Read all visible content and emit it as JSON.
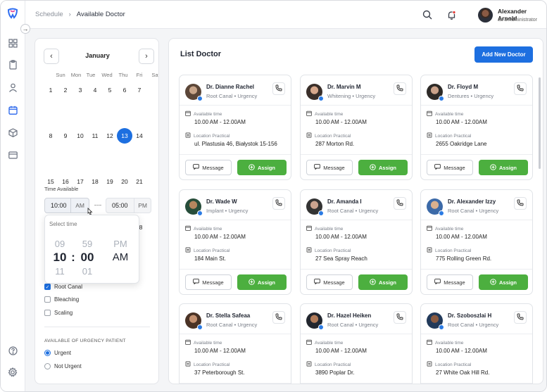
{
  "breadcrumb": {
    "parent": "Schedule",
    "separator": "›",
    "current": "Available Doctor"
  },
  "user": {
    "name": "Alexander Arnold",
    "role": "as a Administrator"
  },
  "calendar": {
    "month": "January",
    "prev_icon": "chevron-left-icon",
    "next_icon": "chevron-right-icon",
    "weekdays": [
      "Sun",
      "Mon",
      "Tue",
      "Wed",
      "Thu",
      "Fri",
      "Sat"
    ],
    "row1": [
      "1",
      "2",
      "3",
      "4",
      "5",
      "6",
      "7"
    ],
    "row2": [
      "8",
      "9",
      "10",
      "11",
      "12",
      "13",
      "14"
    ],
    "row3": [
      "15",
      "16",
      "17",
      "18",
      "19",
      "20",
      "21"
    ],
    "row4_partial": "8",
    "selected_day": "13"
  },
  "time": {
    "label": "Time Available",
    "start": "10:00",
    "start_period": "AM",
    "end": "05:00",
    "end_period": "PM",
    "picker_title": "Select time",
    "hours": [
      "09",
      "10",
      "11"
    ],
    "minutes": [
      "59",
      "00",
      "01"
    ],
    "periods": [
      "PM",
      "AM"
    ],
    "separator": ":"
  },
  "filters": {
    "treatments": [
      {
        "label": "Root Canal",
        "checked": true
      },
      {
        "label": "Bleaching",
        "checked": false
      },
      {
        "label": "Scaling",
        "checked": false
      }
    ],
    "urgency_title": "AVAILABLE OF URGENCY PATIENT",
    "urgency": [
      {
        "label": "Urgent",
        "selected": true
      },
      {
        "label": "Not Urgent",
        "selected": false
      }
    ]
  },
  "list": {
    "title": "List Doctor",
    "add_label": "Add New Doctor",
    "time_label": "Available time",
    "location_label": "Location Practical",
    "message_label": "Message",
    "assign_label": "Assign",
    "doctors": [
      {
        "name": "Dr. Dianne Rachel",
        "spec": "Root Canal • Urgency",
        "time": "10.00 AM - 12.00AM",
        "location": "ul. Plastusia 46, Białystok 15-156"
      },
      {
        "name": "Dr. Marvin M",
        "spec": "Whitening • Urgency",
        "time": "10.00 AM - 12.00AM",
        "location": "287 Morton Rd."
      },
      {
        "name": "Dr. Floyd M",
        "spec": "Dentures • Urgency",
        "time": "10.00 AM - 12.00AM",
        "location": "2655 Oakridge Lane"
      },
      {
        "name": "Dr. Wade W",
        "spec": "Implant • Urgency",
        "time": "10.00 AM - 12.00AM",
        "location": "184 Main St."
      },
      {
        "name": "Dr. Amanda I",
        "spec": "Root Canal • Urgency",
        "time": "10.00 AM - 12.00AM",
        "location": "27 Sea Spray Reach"
      },
      {
        "name": "Dr. Alexander Izzy",
        "spec": "Root Canal • Urgency",
        "time": "10.00 AM - 12.00AM",
        "location": "775 Rolling Green Rd."
      },
      {
        "name": "Dr. Stella Safeaa",
        "spec": "Root Canal • Urgency",
        "time": "10.00 AM - 12.00AM",
        "location": "37 Peterborough St."
      },
      {
        "name": "Dr. Hazel Heiken",
        "spec": "Root Canal • Urgency",
        "time": "10.00 AM - 12.00AM",
        "location": "3890 Poplar Dr."
      },
      {
        "name": "Dr. Szoboszlai H",
        "spec": "Root Canal • Urgency",
        "time": "10.00 AM - 12.00AM",
        "location": "27 White Oak Hill Rd."
      }
    ]
  },
  "colors": {
    "primary": "#1d6fe0",
    "assign": "#4caf3f",
    "background": "#f4f5f7"
  }
}
